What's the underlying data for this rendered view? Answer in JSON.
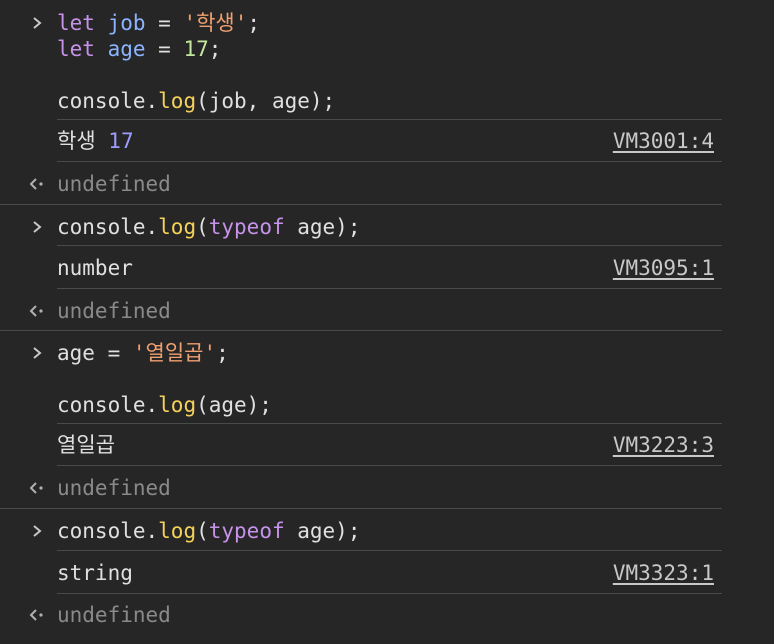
{
  "entries": [
    {
      "type": "input",
      "lines": [
        [
          {
            "text": "let",
            "role": "keyword"
          },
          {
            "text": " ",
            "role": "plain"
          },
          {
            "text": "job",
            "role": "variable"
          },
          {
            "text": " = ",
            "role": "plain"
          },
          {
            "text": "'학생'",
            "role": "string"
          },
          {
            "text": ";",
            "role": "plain"
          }
        ],
        [
          {
            "text": "let",
            "role": "keyword"
          },
          {
            "text": " ",
            "role": "plain"
          },
          {
            "text": "age",
            "role": "variable"
          },
          {
            "text": " = ",
            "role": "plain"
          },
          {
            "text": "17",
            "role": "number"
          },
          {
            "text": ";",
            "role": "plain"
          }
        ]
      ]
    },
    {
      "type": "input-continued",
      "lines": [
        [
          {
            "text": "console.",
            "role": "plain"
          },
          {
            "text": "log",
            "role": "function"
          },
          {
            "text": "(job, age);",
            "role": "plain"
          }
        ]
      ]
    },
    {
      "type": "output",
      "parts": [
        {
          "text": "학생",
          "role": "plain"
        },
        {
          "text": " ",
          "role": "plain"
        },
        {
          "text": "17",
          "role": "numout"
        }
      ],
      "source": "VM3001:4"
    },
    {
      "type": "result",
      "text": "undefined"
    },
    {
      "type": "input",
      "lines": [
        [
          {
            "text": "console.",
            "role": "plain"
          },
          {
            "text": "log",
            "role": "function"
          },
          {
            "text": "(",
            "role": "plain"
          },
          {
            "text": "typeof",
            "role": "keyword"
          },
          {
            "text": " age);",
            "role": "plain"
          }
        ]
      ]
    },
    {
      "type": "output",
      "parts": [
        {
          "text": "number",
          "role": "plain"
        }
      ],
      "source": "VM3095:1"
    },
    {
      "type": "result",
      "text": "undefined"
    },
    {
      "type": "input",
      "lines": [
        [
          {
            "text": "age = ",
            "role": "plain"
          },
          {
            "text": "'열일곱'",
            "role": "string"
          },
          {
            "text": ";",
            "role": "plain"
          }
        ]
      ]
    },
    {
      "type": "input-continued",
      "lines": [
        [
          {
            "text": "console.",
            "role": "plain"
          },
          {
            "text": "log",
            "role": "function"
          },
          {
            "text": "(age);",
            "role": "plain"
          }
        ]
      ]
    },
    {
      "type": "output",
      "parts": [
        {
          "text": "열일곱",
          "role": "plain"
        }
      ],
      "source": "VM3223:3"
    },
    {
      "type": "result",
      "text": "undefined"
    },
    {
      "type": "input",
      "lines": [
        [
          {
            "text": "console.",
            "role": "plain"
          },
          {
            "text": "log",
            "role": "function"
          },
          {
            "text": "(",
            "role": "plain"
          },
          {
            "text": "typeof",
            "role": "keyword"
          },
          {
            "text": " age);",
            "role": "plain"
          }
        ]
      ]
    },
    {
      "type": "output",
      "parts": [
        {
          "text": "string",
          "role": "plain"
        }
      ],
      "source": "VM3323:1"
    },
    {
      "type": "result",
      "text": "undefined"
    }
  ],
  "icons": {
    "prompt": "chevron-right-icon",
    "result": "return-arrow-icon"
  },
  "colors": {
    "background": "#262626",
    "keyword": "#c792ea",
    "variable": "#8cb4ff",
    "string": "#f0a070",
    "number": "#c5e8a0",
    "function": "#f5d25a",
    "numout": "#9d9dff",
    "undefined": "#8a8a8a"
  }
}
